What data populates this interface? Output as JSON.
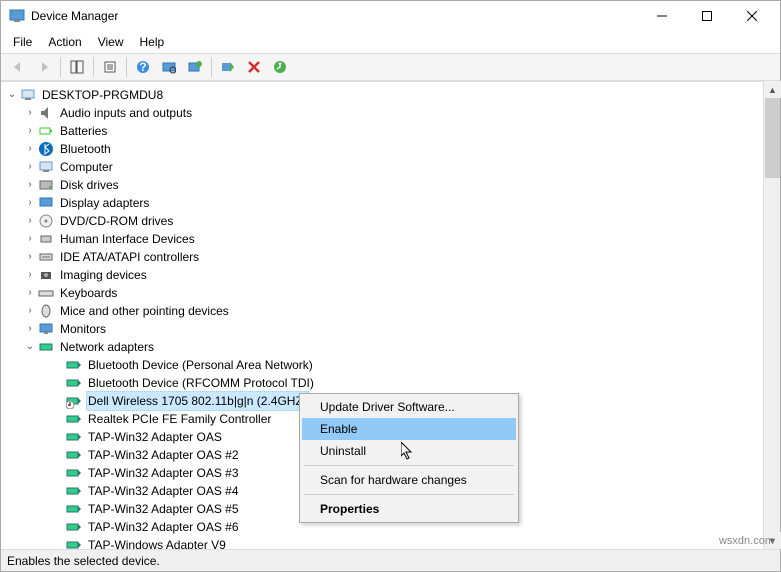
{
  "window": {
    "title": "Device Manager"
  },
  "menu": {
    "file": "File",
    "action": "Action",
    "view": "View",
    "help": "Help"
  },
  "tree": {
    "root": "DESKTOP-PRGMDU8",
    "cats": [
      "Audio inputs and outputs",
      "Batteries",
      "Bluetooth",
      "Computer",
      "Disk drives",
      "Display adapters",
      "DVD/CD-ROM drives",
      "Human Interface Devices",
      "IDE ATA/ATAPI controllers",
      "Imaging devices",
      "Keyboards",
      "Mice and other pointing devices",
      "Monitors",
      "Network adapters"
    ],
    "net_children": [
      "Bluetooth Device (Personal Area Network)",
      "Bluetooth Device (RFCOMM Protocol TDI)",
      "Dell Wireless 1705 802.11b|g|n (2.4GHZ)",
      "Realtek PCIe FE Family Controller",
      "TAP-Win32 Adapter OAS",
      "TAP-Win32 Adapter OAS #2",
      "TAP-Win32 Adapter OAS #3",
      "TAP-Win32 Adapter OAS #4",
      "TAP-Win32 Adapter OAS #5",
      "TAP-Win32 Adapter OAS #6",
      "TAP-Windows Adapter V9"
    ]
  },
  "context_menu": {
    "update": "Update Driver Software...",
    "enable": "Enable",
    "uninstall": "Uninstall",
    "scan": "Scan for hardware changes",
    "properties": "Properties"
  },
  "status": "Enables the selected device.",
  "watermark": "wsxdn.com"
}
